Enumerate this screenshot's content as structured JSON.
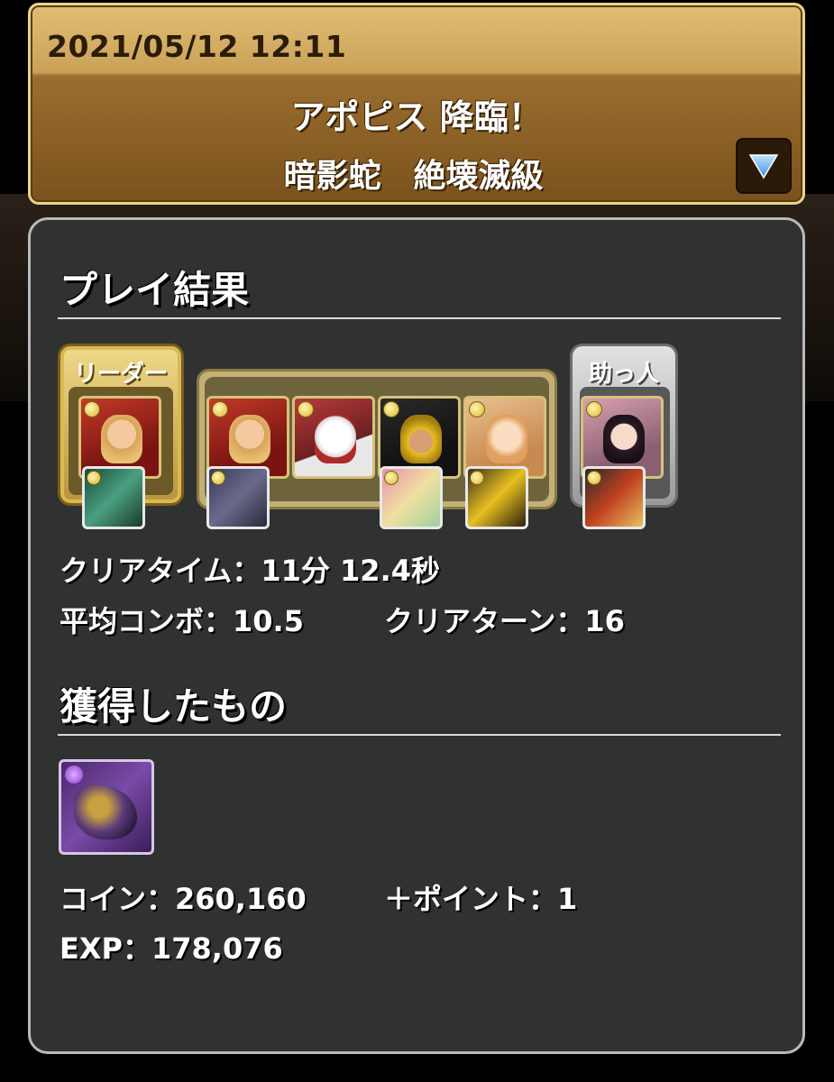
{
  "header": {
    "timestamp": "2021/05/12 12:11",
    "dungeon_title": "アポピス 降臨！",
    "difficulty": "暗影蛇　絶壊滅級",
    "toggle_icon": "triangle-down-icon"
  },
  "result": {
    "section_title": "プレイ結果",
    "leader_label": "リーダー",
    "helper_label": "助っ人",
    "clear_time": "クリアタイム：11分 12.4秒",
    "avg_combo": "平均コンボ：10.5",
    "clear_turns": "クリアターン：16"
  },
  "rewards": {
    "section_title": "獲得したもの",
    "coins": "コイン：260,160",
    "plus_points": "＋ポイント：1",
    "exp": "EXP：178,076"
  },
  "colors": {
    "header_gold": "#caa25a",
    "panel_bg": "#303131",
    "leader_gold": "#f0d98a",
    "helper_silver": "#e2e2e2"
  }
}
